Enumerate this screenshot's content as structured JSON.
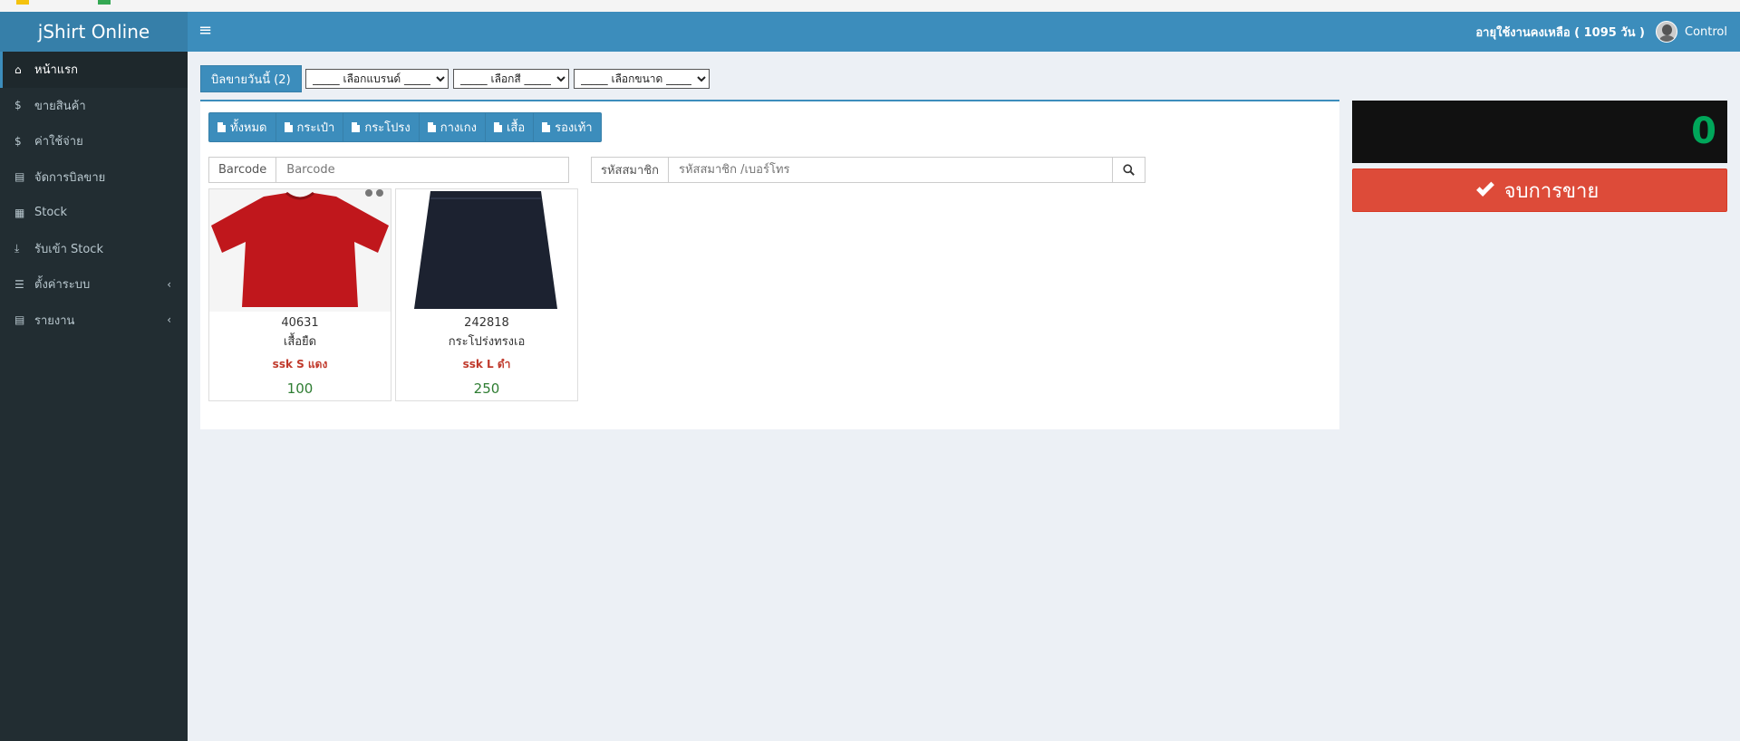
{
  "app": {
    "brand": "jShirt Online"
  },
  "sidebar": {
    "items": [
      {
        "label": "หน้าแรก",
        "icon": "home-icon",
        "active": true
      },
      {
        "label": "ขายสินค้า",
        "icon": "dollar-icon"
      },
      {
        "label": "ค่าใช้จ่าย",
        "icon": "dollar-icon"
      },
      {
        "label": "จัดการบิลขาย",
        "icon": "file-icon"
      },
      {
        "label": "Stock",
        "icon": "list-icon"
      },
      {
        "label": "รับเข้า Stock",
        "icon": "download-icon"
      },
      {
        "label": "ตั้งค่าระบบ",
        "icon": "tasks-icon",
        "has_submenu": true
      },
      {
        "label": "รายงาน",
        "icon": "file-icon",
        "has_submenu": true
      }
    ]
  },
  "header": {
    "remaining": "อายุใช้งานคงเหลือ ( 1095 วัน )",
    "user": "Control"
  },
  "filters": {
    "today_bills": "บิลขายวันนี้ (2)",
    "brand": "_____ เลือกแบรนด์ _____",
    "color": "_____ เลือกสี _____",
    "size": "_____ เลือกขนาด _____"
  },
  "tabs": [
    "ทั้งหมด",
    "กระเป๋า",
    "กระโปรง",
    "กางเกง",
    "เสื้อ",
    "รองเท้า"
  ],
  "barcode": {
    "label": "Barcode",
    "placeholder": "Barcode"
  },
  "member": {
    "label": "รหัสสมาชิก",
    "placeholder": "รหัสสมาชิก /เบอร์โทร"
  },
  "products": [
    {
      "code": "40631",
      "name": "เสื้อยืด",
      "variant": "ssk S แดง",
      "price": "100"
    },
    {
      "code": "242818",
      "name": "กระโปร่งทรงเอ",
      "variant": "ssk L ดำ",
      "price": "250"
    }
  ],
  "total": {
    "value": "0"
  },
  "finish_button": {
    "label": "จบการขาย"
  },
  "colors": {
    "primary": "#3c8dbc",
    "sidebar": "#222d32",
    "danger": "#dd4b39",
    "success": "#00a65a"
  }
}
